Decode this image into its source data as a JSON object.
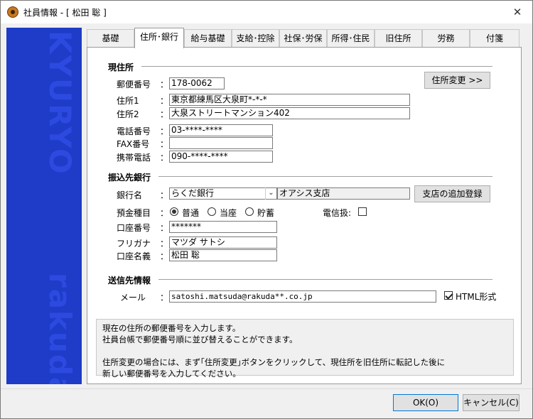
{
  "window": {
    "title": "社員情報 - [ 松田 聡 ]",
    "close_label": "✕"
  },
  "sidebar": {
    "top_text": "KYURYO",
    "bottom_text": "rakuda"
  },
  "tabs": [
    {
      "label": "基礎"
    },
    {
      "label": "住所･銀行",
      "active": true
    },
    {
      "label": "給与基礎"
    },
    {
      "label": "支給･控除"
    },
    {
      "label": "社保･労保"
    },
    {
      "label": "所得･住民"
    },
    {
      "label": "旧住所"
    },
    {
      "label": "労務"
    },
    {
      "label": "付箋"
    }
  ],
  "address": {
    "section_title": "現住所",
    "postal_label": "郵便番号",
    "postal_value": "178-0062",
    "change_button": "住所変更 >>",
    "address1_label": "住所1",
    "address1_value": "東京都練馬区大泉町*-*-*",
    "address2_label": "住所2",
    "address2_value": "大泉ストリートマンション402",
    "phone_label": "電話番号",
    "phone_value": "03-****-****",
    "fax_label": "FAX番号",
    "fax_value": "",
    "mobile_label": "携帯電話",
    "mobile_value": "090-****-****"
  },
  "bank": {
    "section_title": "振込先銀行",
    "bank_label": "銀行名",
    "bank_value": "らくだ銀行",
    "branch_value": "オアシス支店",
    "add_branch_button": "支店の追加登録",
    "deposit_label": "預金種目",
    "deposit_options": [
      "普通",
      "当座",
      "貯蓄"
    ],
    "deposit_selected": "普通",
    "wire_label": "電信扱:",
    "wire_checked": false,
    "account_label": "口座番号",
    "account_value": "*******",
    "kana_label": "フリガナ",
    "kana_value": "マツダ サトシ",
    "holder_label": "口座名義",
    "holder_value": "松田 聡"
  },
  "send": {
    "section_title": "送信先情報",
    "mail_label": "メール",
    "mail_value": "satoshi.matsuda@rakuda**.co.jp",
    "html_label": "HTML形式",
    "html_checked": true
  },
  "colon": "：",
  "help": {
    "line1": "現在の住所の郵便番号を入力します。",
    "line2": "社員台帳で郵便番号順に並び替えることができます。",
    "line3": "住所変更の場合には、まず｢住所変更｣ボタンをクリックして、現住所を旧住所に転記した後に",
    "line4": "新しい郵便番号を入力してください。"
  },
  "footer": {
    "ok": "OK(O)",
    "cancel": "キャンセル(C)"
  },
  "colors": {
    "side_panel": "#1e3cc8",
    "side_text": "#2d4ae0"
  }
}
